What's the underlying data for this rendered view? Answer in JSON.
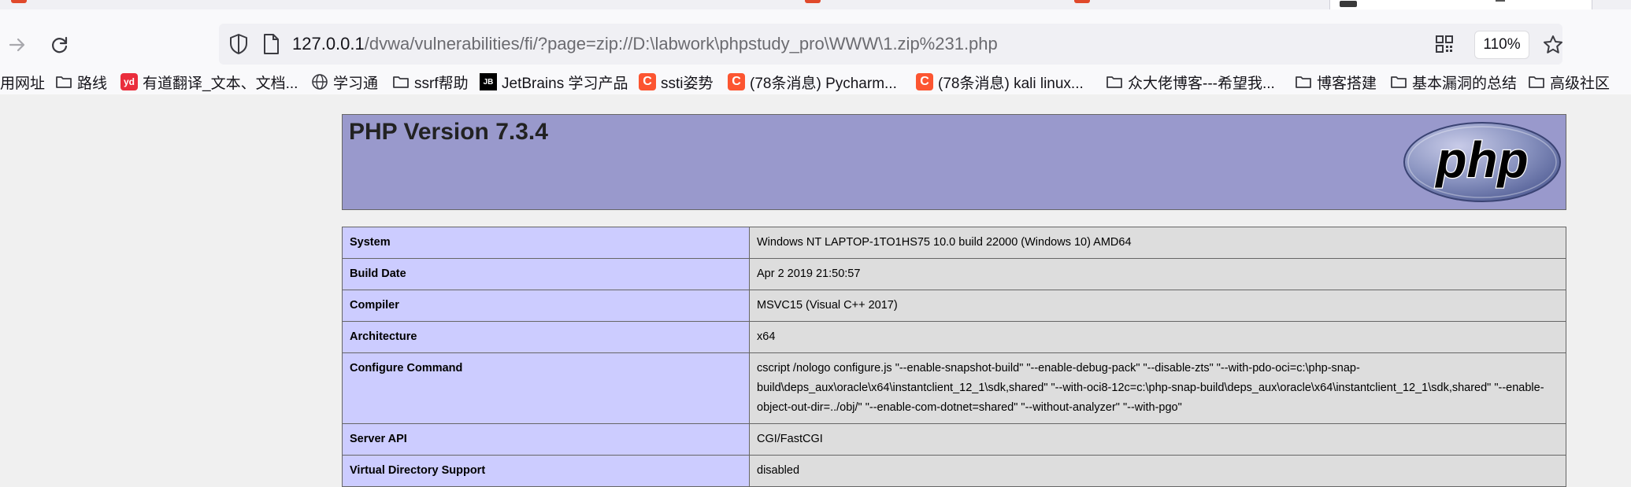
{
  "browser": {
    "url_host": "127.0.0.1",
    "url_path": "/dvwa/vulnerabilities/fi/?page=zip://D:\\labwork\\phpstudy_pro\\WWW\\1.zip%231.php",
    "zoom": "110%"
  },
  "bookmarks": [
    {
      "label": "用网址",
      "icon": "partial-icon"
    },
    {
      "label": "路线",
      "icon": "folder-icon"
    },
    {
      "label": "有道翻译_文本、文档...",
      "icon": "youdao-icon",
      "tile": "yd"
    },
    {
      "label": "学习通",
      "icon": "globe-icon"
    },
    {
      "label": "ssrf帮助",
      "icon": "folder-icon"
    },
    {
      "label": "JetBrains 学习产品",
      "icon": "jetbrains-icon",
      "tile": "JB"
    },
    {
      "label": "ssti姿势",
      "icon": "csdn-icon",
      "tile": "C"
    },
    {
      "label": "(78条消息) Pycharm...",
      "icon": "csdn-icon",
      "tile": "C"
    },
    {
      "label": "(78条消息) kali linux...",
      "icon": "csdn-icon",
      "tile": "C"
    },
    {
      "label": "众大佬博客---希望我...",
      "icon": "folder-icon"
    },
    {
      "label": "博客搭建",
      "icon": "folder-icon"
    },
    {
      "label": "基本漏洞的总结",
      "icon": "folder-icon"
    },
    {
      "label": "高级社区",
      "icon": "folder-icon"
    }
  ],
  "php": {
    "title": "PHP Version 7.3.4",
    "logo_text": "php"
  },
  "info_rows": [
    {
      "key": "System",
      "value": "Windows NT LAPTOP-1TO1HS75 10.0 build 22000 (Windows 10) AMD64"
    },
    {
      "key": "Build Date",
      "value": "Apr 2 2019 21:50:57"
    },
    {
      "key": "Compiler",
      "value": "MSVC15 (Visual C++ 2017)"
    },
    {
      "key": "Architecture",
      "value": "x64"
    },
    {
      "key": "Configure Command",
      "value": "cscript /nologo configure.js \"--enable-snapshot-build\" \"--enable-debug-pack\" \"--disable-zts\" \"--with-pdo-oci=c:\\php-snap-build\\deps_aux\\oracle\\x64\\instantclient_12_1\\sdk,shared\" \"--with-oci8-12c=c:\\php-snap-build\\deps_aux\\oracle\\x64\\instantclient_12_1\\sdk,shared\" \"--enable-object-out-dir=../obj/\" \"--enable-com-dotnet=shared\" \"--without-analyzer\" \"--with-pgo\""
    },
    {
      "key": "Server API",
      "value": "CGI/FastCGI"
    },
    {
      "key": "Virtual Directory Support",
      "value": "disabled"
    }
  ],
  "colors": {
    "header_bg": "#9999cc",
    "key_bg": "#ccccff",
    "value_bg": "#dddddd",
    "border": "#666666"
  }
}
